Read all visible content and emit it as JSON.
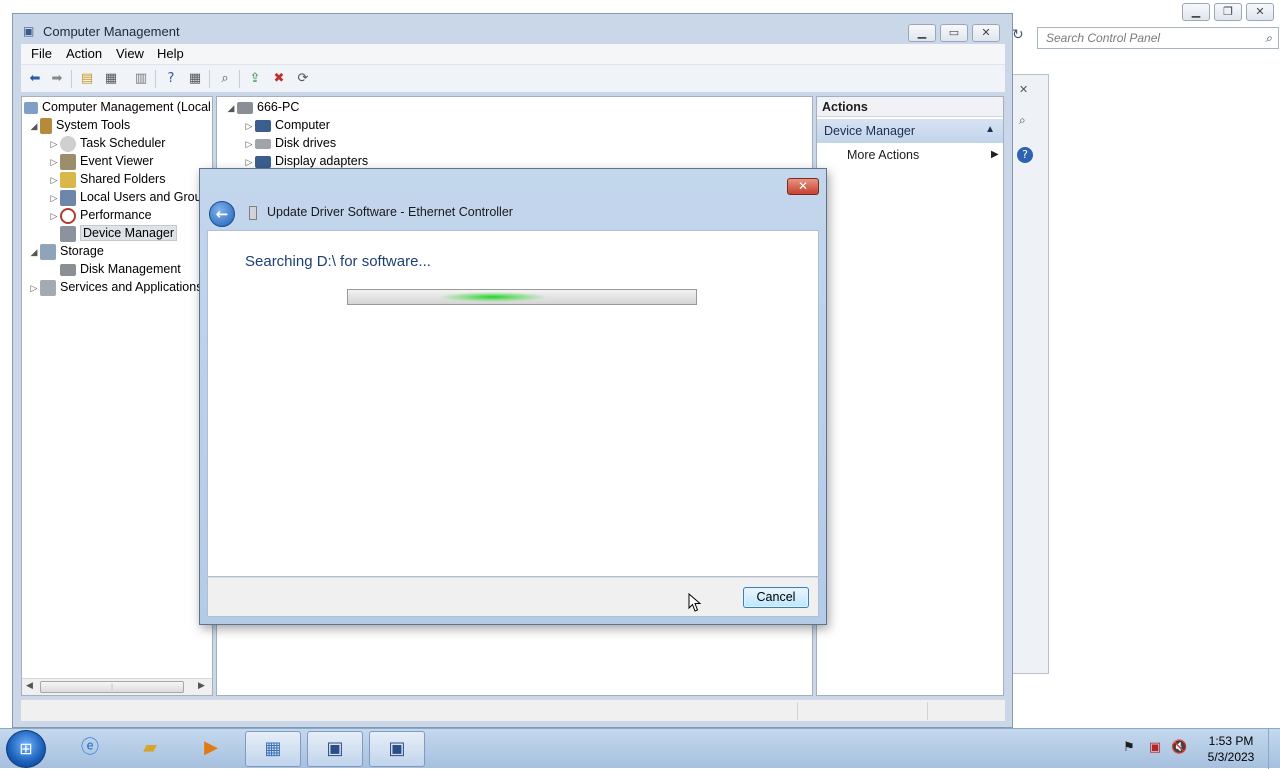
{
  "control_panel": {
    "search_placeholder": "Search Control Panel",
    "minimize_icon": "minimize-icon",
    "restore_icon": "restore-icon",
    "close_icon": "close-icon"
  },
  "computer_management": {
    "title": "Computer Management",
    "menu": [
      "File",
      "Action",
      "View",
      "Help"
    ],
    "tree": {
      "root": "Computer Management (Local",
      "system_tools": "System Tools",
      "task_scheduler": "Task Scheduler",
      "event_viewer": "Event Viewer",
      "shared_folders": "Shared Folders",
      "local_users": "Local Users and Group",
      "performance": "Performance",
      "device_manager": "Device Manager",
      "storage": "Storage",
      "disk_management": "Disk Management",
      "services": "Services and Applications"
    },
    "devices": {
      "root": "666-PC",
      "items": [
        "Computer",
        "Disk drives",
        "Display adapters"
      ]
    },
    "actions": {
      "header": "Actions",
      "group": "Device Manager",
      "more": "More Actions"
    }
  },
  "dialog": {
    "title": "Update Driver Software - Ethernet Controller",
    "heading": "Searching D:\\ for software...",
    "cancel_label": "Cancel",
    "close_label": "✕"
  },
  "taskbar": {
    "time": "1:53 PM",
    "date": "5/3/2023"
  },
  "colors": {
    "accent": "#1e3f75",
    "progress": "#24d02c",
    "window_frame": "#c3d6ec"
  }
}
